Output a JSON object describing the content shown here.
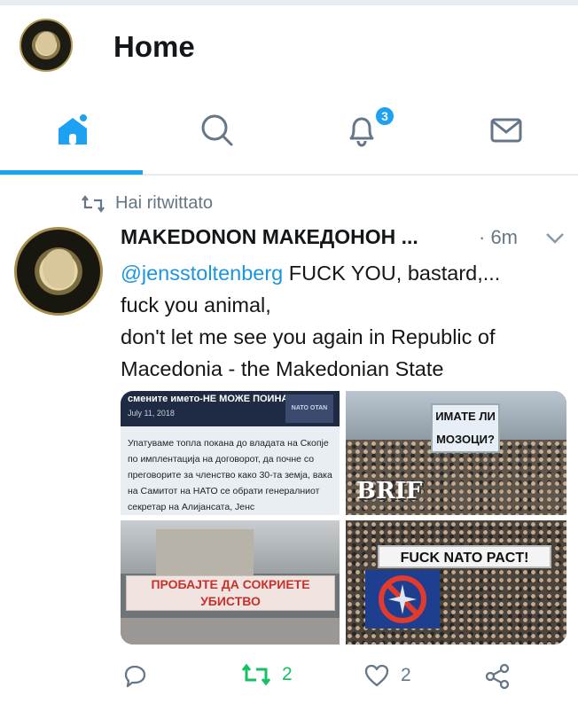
{
  "header": {
    "title": "Home"
  },
  "tabs": [
    {
      "name": "home",
      "icon": "home-icon",
      "active": true
    },
    {
      "name": "search",
      "icon": "search-icon"
    },
    {
      "name": "notifications",
      "icon": "bell-icon",
      "badge": "3"
    },
    {
      "name": "messages",
      "icon": "mail-icon"
    }
  ],
  "tweet": {
    "context": "Hai ritwittato",
    "author": "MAKEDONON МАКЕДОНОН ...",
    "time": "· 6m",
    "mention": "@jensstoltenberg",
    "text_line1": " FUCK YOU, bastard,...",
    "text_line2": "fuck you animal,",
    "text_line3": "don't let me see you again in Republic of",
    "text_line4": "Macedonia - the Makedonian State",
    "media": {
      "news_title": "смените името-НЕ МОЖЕ ПОИНАКУ",
      "news_date": "July 11, 2018",
      "news_thumb": "NATO OTAN",
      "news_body": "Упатуваме топла покана до владата на Скопје по имплентација на договорот, да почне со преговорите за членство како 30-та земја, вака на Самитот на НАТО се обрати генералниот секретар на Алијансата, Јенс",
      "sign_text": "ИМАТЕ ЛИ МОЗОЦИ?",
      "brif_logo": "BRIF",
      "banner_text": "ПРОБАЈТЕ ДА СОКРИЕТЕ УБИСТВО",
      "nato_banner": "FUCK NATO PACT!"
    },
    "actions": {
      "reply_count": "",
      "retweet_count": "2",
      "like_count": "2"
    }
  },
  "colors": {
    "accent": "#1da1f2",
    "retweet": "#17bf63",
    "muted": "#657786"
  }
}
